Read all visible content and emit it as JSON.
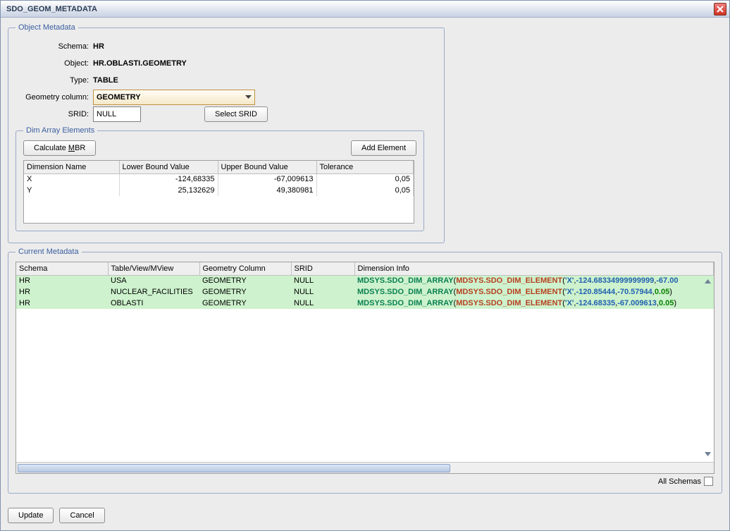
{
  "window": {
    "title": "SDO_GEOM_METADATA"
  },
  "object_metadata": {
    "legend": "Object Metadata",
    "labels": {
      "schema": "Schema:",
      "object": "Object:",
      "type": "Type:",
      "geom_col": "Geometry column:",
      "srid": "SRID:"
    },
    "values": {
      "schema": "HR",
      "object": "HR.OBLASTI.GEOMETRY",
      "type": "TABLE",
      "geom_col": "GEOMETRY",
      "srid": "NULL"
    },
    "buttons": {
      "select_srid": "Select SRID"
    }
  },
  "dim_array": {
    "legend": "Dim Array Elements",
    "buttons": {
      "calc_mbr": "Calculate MBR",
      "add_element": "Add Element"
    },
    "headers": {
      "dim_name": "Dimension Name",
      "lower": "Lower Bound Value",
      "upper": "Upper Bound Value",
      "tolerance": "Tolerance"
    },
    "rows": [
      {
        "name": "X",
        "lower": "-124,68335",
        "upper": "-67,009613",
        "tol": "0,05"
      },
      {
        "name": "Y",
        "lower": "25,132629",
        "upper": "49,380981",
        "tol": "0,05"
      }
    ]
  },
  "current": {
    "legend": "Current Metadata",
    "headers": {
      "schema": "Schema",
      "table": "Table/View/MView",
      "geom_col": "Geometry Column",
      "srid": "SRID",
      "dim_info": "Dimension Info"
    },
    "rows": [
      {
        "schema": "HR",
        "table": "USA",
        "geom": "GEOMETRY",
        "srid": "NULL",
        "dim": {
          "p1": "MDSYS.SDO_DIM_ARRAY",
          "p2": "MDSYS.SDO_DIM_ELEMENT",
          "axis": "X",
          "v1": "-124.68334999999999",
          "v2": "-67.00"
        }
      },
      {
        "schema": "HR",
        "table": "NUCLEAR_FACILITIES",
        "geom": "GEOMETRY",
        "srid": "NULL",
        "dim": {
          "p1": "MDSYS.SDO_DIM_ARRAY",
          "p2": "MDSYS.SDO_DIM_ELEMENT",
          "axis": "X",
          "v1": "-120.85444",
          "v2": "-70.57944",
          "scale": "0.05"
        }
      },
      {
        "schema": "HR",
        "table": "OBLASTI",
        "geom": "GEOMETRY",
        "srid": "NULL",
        "dim": {
          "p1": "MDSYS.SDO_DIM_ARRAY",
          "p2": "MDSYS.SDO_DIM_ELEMENT",
          "axis": "X",
          "v1": "-124.68335",
          "v2": "-67.009613",
          "scale": "0.05"
        }
      }
    ],
    "all_schemas": "All Schemas"
  },
  "footer": {
    "update": "Update",
    "cancel": "Cancel"
  }
}
